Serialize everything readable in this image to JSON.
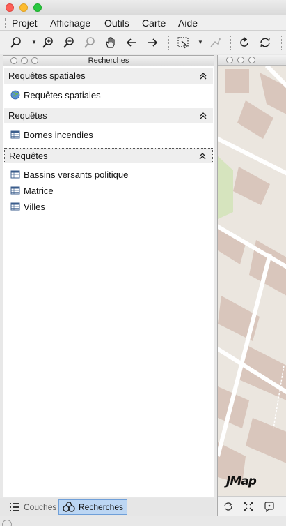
{
  "menubar": {
    "items": [
      "Projet",
      "Affichage",
      "Outils",
      "Carte",
      "Aide"
    ]
  },
  "toolbar": {
    "icons": [
      "zoom-tool-icon",
      "zoom-in-icon",
      "zoom-out-icon",
      "zoom-full-icon",
      "pan-hand-icon",
      "previous-view-icon",
      "next-view-icon",
      "select-area-icon",
      "measure-icon",
      "refresh-icon",
      "reload-icon"
    ]
  },
  "panel": {
    "title": "Recherches",
    "sections": [
      {
        "label": "Requêtes spatiales",
        "items": [
          "Requêtes spatiales"
        ]
      },
      {
        "label": "Requêtes",
        "items": [
          "Bornes incendies"
        ]
      },
      {
        "label": "Requêtes",
        "items": [
          "Bassins versants politique",
          "Matrice",
          "Villes"
        ]
      }
    ]
  },
  "map": {
    "logo": "JMap"
  },
  "tabs": {
    "couches": "Couches",
    "recherches": "Recherches"
  }
}
